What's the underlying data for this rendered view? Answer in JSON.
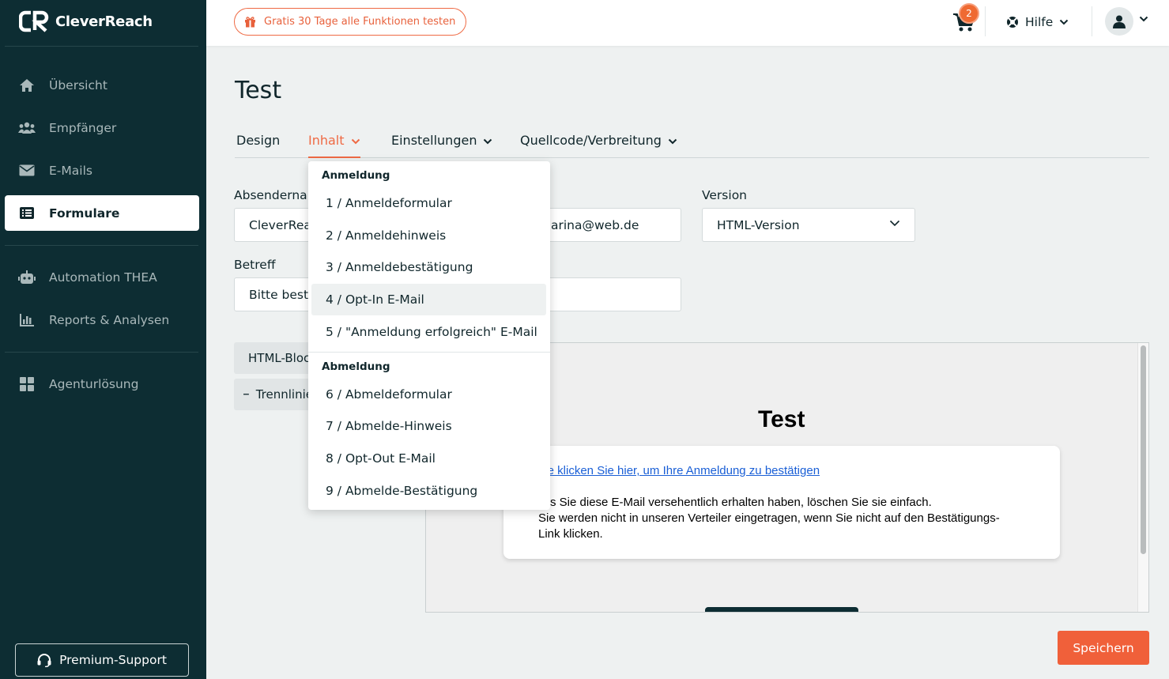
{
  "brand": {
    "name": "CleverReach",
    "accent": "#ef6a44",
    "sidebar_bg": "#0d2d33"
  },
  "sidebar": {
    "items": [
      {
        "label": "Übersicht",
        "icon": "home-icon"
      },
      {
        "label": "Empfänger",
        "icon": "users-icon"
      },
      {
        "label": "E-Mails",
        "icon": "envelope-icon"
      },
      {
        "label": "Formulare",
        "icon": "form-list-icon",
        "active": true
      },
      {
        "label": "Automation THEA",
        "icon": "robot-icon"
      },
      {
        "label": "Reports & Analysen",
        "icon": "bar-chart-icon"
      },
      {
        "label": "Agenturlösung",
        "icon": "grid-icon"
      }
    ],
    "premium_label": "Premium-Support"
  },
  "topbar": {
    "trial_label": "Gratis 30 Tage alle Funktionen testen",
    "cart_count": "2",
    "help_label": "Hilfe"
  },
  "page": {
    "title": "Test",
    "tabs": [
      "Design",
      "Inhalt",
      "Einstellungen",
      "Quellcode/Verbreitung"
    ],
    "active_tab": "Inhalt"
  },
  "form": {
    "sender_label": "Absendername",
    "sender_value": "CleverReach",
    "email_value": "arina@web.de",
    "version_label": "Version",
    "version_value": "HTML-Version",
    "subject_label": "Betreff",
    "subject_value": "Bitte bestätigen"
  },
  "blocks": [
    "HTML-Block",
    "Trennlinie"
  ],
  "preview": {
    "title": "Test",
    "link": "itte klicken Sie hier, um Ihre Anmeldung zu bestätigen",
    "line1": "alls Sie diese E-Mail versehentlich erhalten haben, löschen Sie sie einfach.",
    "line2": "Sie werden nicht in unseren Verteiler eingetragen, wenn Sie nicht auf den Bestätigungs-",
    "line3": "Link klicken."
  },
  "save_label": "Speichern",
  "dropdown": {
    "group1": "Anmeldung",
    "group1_items": [
      "1 / Anmeldeformular",
      "2 / Anmeldehinweis",
      "3 / Anmeldebestätigung",
      "4 / Opt-In E-Mail",
      "5 / \"Anmeldung erfolgreich\" E-Mail"
    ],
    "group2": "Abmeldung",
    "group2_items": [
      "6 / Abmeldeformular",
      "7 / Abmelde-Hinweis",
      "8 / Opt-Out E-Mail",
      "9 / Abmelde-Bestätigung"
    ],
    "hovered": "4 / Opt-In E-Mail"
  }
}
